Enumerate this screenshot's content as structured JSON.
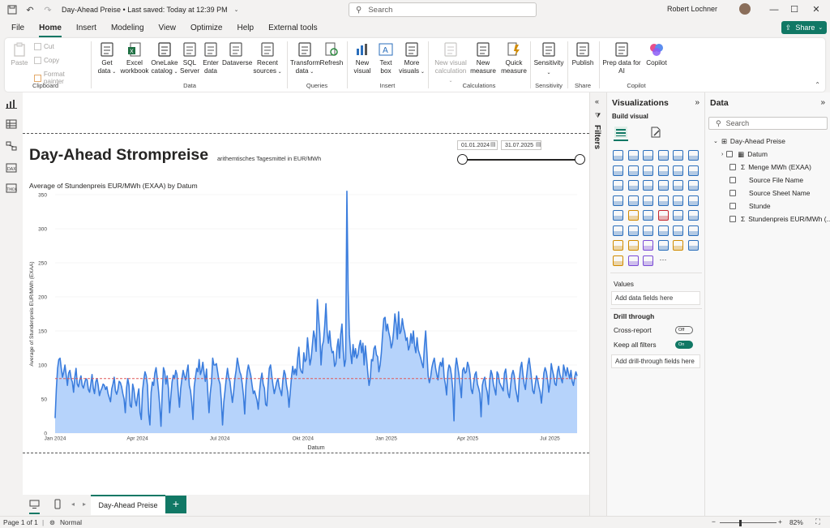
{
  "titlebar": {
    "title": "Day-Ahead Preise • Last saved: Today at 12:39 PM",
    "search_placeholder": "Search",
    "user_name": "Robert Lochner"
  },
  "menu": {
    "items": [
      "File",
      "Home",
      "Insert",
      "Modeling",
      "View",
      "Optimize",
      "Help",
      "External tools"
    ],
    "active": "Home",
    "share": "Share"
  },
  "ribbon": {
    "clipboard": {
      "label": "Clipboard",
      "paste": "Paste",
      "cut": "Cut",
      "copy": "Copy",
      "format_painter": "Format painter"
    },
    "data": {
      "label": "Data",
      "buttons": [
        "Get data",
        "Excel workbook",
        "OneLake catalog",
        "SQL Server",
        "Enter data",
        "Dataverse",
        "Recent sources"
      ]
    },
    "queries": {
      "label": "Queries",
      "buttons": [
        "Transform data",
        "Refresh"
      ]
    },
    "insert": {
      "label": "Insert",
      "buttons": [
        "New visual",
        "Text box",
        "More visuals"
      ]
    },
    "calculations": {
      "label": "Calculations",
      "buttons": [
        "New visual calculation",
        "New measure",
        "Quick measure"
      ]
    },
    "sensitivity": {
      "label": "Sensitivity",
      "buttons": [
        "Sensitivity"
      ]
    },
    "share": {
      "label": "Share",
      "buttons": [
        "Publish"
      ]
    },
    "copilot": {
      "label": "Copilot",
      "buttons": [
        "Prep data for AI",
        "Copilot"
      ]
    }
  },
  "report": {
    "title": "Day-Ahead Strompreise",
    "subtitle": "arithemtisches Tagesmittel in EUR/MWh",
    "visual_title": "Average of Stundenpreis EUR/MWh (EXAA) by Datum",
    "slicer_start": "01.01.2024",
    "slicer_end": "31.07.2025"
  },
  "chart_data": {
    "type": "area",
    "title": "Average of Stundenpreis EUR/MWh (EXAA) by Datum",
    "xlabel": "Datum",
    "ylabel": "Average of Stundenpreis EUR/MWh (EXAA)",
    "ylim": [
      0,
      350
    ],
    "yticks": [
      0,
      50,
      100,
      150,
      200,
      250,
      300,
      350
    ],
    "xticks": [
      "Jan 2024",
      "Apr 2024",
      "Jul 2024",
      "Okt 2024",
      "Jan 2025",
      "Apr 2025",
      "Jul 2025"
    ],
    "average_line": 80,
    "x_start": "2024-01-01",
    "x_end": "2025-07-31",
    "values": [
      22,
      65,
      95,
      108,
      110,
      95,
      82,
      90,
      100,
      85,
      70,
      88,
      92,
      80,
      75,
      60,
      82,
      95,
      72,
      68,
      78,
      84,
      70,
      66,
      74,
      80,
      78,
      64,
      60,
      72,
      86,
      66,
      58,
      75,
      80,
      70,
      55,
      62,
      66,
      72,
      70,
      64,
      68,
      58,
      52,
      46,
      65,
      72,
      82,
      62,
      57,
      64,
      76,
      74,
      68,
      58,
      50,
      30,
      66,
      80,
      70,
      40,
      38,
      72,
      64,
      48,
      40,
      55,
      65,
      30,
      20,
      62,
      78,
      90,
      84,
      70,
      28,
      12,
      60,
      75,
      70,
      88,
      96,
      80,
      62,
      40,
      10,
      58,
      96,
      90,
      72,
      84,
      66,
      30,
      54,
      75,
      85,
      80,
      92,
      86,
      60,
      38,
      65,
      80,
      92,
      84,
      78,
      90,
      100,
      70,
      62,
      45,
      20,
      68,
      82,
      95,
      90,
      108,
      86,
      92,
      104,
      88,
      76,
      94,
      60,
      30,
      58,
      74,
      110,
      100,
      100,
      102,
      90,
      78,
      72,
      48,
      12,
      45,
      62,
      80,
      95,
      82,
      76,
      60,
      45,
      60,
      80,
      92,
      110,
      100,
      90,
      85,
      72,
      55,
      28,
      70,
      90,
      100,
      92,
      84,
      70,
      58,
      62,
      55,
      48,
      35,
      60,
      78,
      88,
      72,
      66,
      42,
      40,
      72,
      95,
      100,
      84,
      70,
      58,
      66,
      75,
      80,
      68,
      62,
      55,
      78,
      92,
      86,
      70,
      60,
      38,
      60,
      82,
      98,
      86,
      94,
      85,
      110,
      126,
      96,
      90,
      88,
      118,
      105,
      108,
      140,
      120,
      100,
      110,
      130,
      150,
      140,
      120,
      196,
      170,
      146,
      100,
      128,
      135,
      158,
      190,
      148,
      132,
      150,
      128,
      118,
      120,
      98,
      102,
      126,
      138,
      110,
      145,
      160,
      122,
      98,
      108,
      355,
      210,
      145,
      118,
      102,
      130,
      112,
      124,
      110,
      115,
      128,
      136,
      118,
      132,
      100,
      128,
      110,
      88,
      70,
      80,
      108,
      106,
      124,
      128,
      115,
      112,
      90,
      100,
      118,
      145,
      168,
      170,
      150,
      160,
      148,
      140,
      125,
      132,
      150,
      175,
      160,
      138,
      178,
      146,
      150,
      168,
      155,
      148,
      136,
      140,
      122,
      128,
      146,
      132,
      150,
      128,
      118,
      140,
      122,
      116,
      110,
      102,
      96,
      128,
      150,
      118,
      84,
      74,
      82,
      96,
      104,
      110,
      96,
      86,
      78,
      96,
      104,
      98,
      110,
      82,
      72,
      56,
      90,
      100,
      96,
      84,
      64,
      18,
      94,
      110,
      98,
      86,
      70,
      52,
      92,
      96,
      88,
      90,
      104,
      98,
      86,
      64,
      58,
      74,
      86,
      90,
      72,
      66,
      58,
      24,
      70,
      78,
      82,
      68,
      60,
      42,
      78,
      92,
      86,
      72,
      64,
      56,
      90,
      86,
      74,
      70,
      66,
      62,
      88,
      94,
      76,
      58,
      52,
      70,
      86,
      92,
      84,
      66,
      56,
      46,
      78,
      96,
      104,
      86,
      72,
      64,
      84,
      100,
      110,
      96,
      80,
      62,
      58,
      72,
      84,
      78,
      68,
      60,
      44,
      64,
      88,
      96,
      90,
      78,
      60,
      74,
      102,
      92,
      84,
      72,
      70,
      90,
      98,
      86,
      80,
      74,
      100,
      92,
      84,
      96,
      88,
      80,
      92,
      76,
      70,
      82,
      90,
      84
    ]
  },
  "pages": {
    "tab": "Day-Ahead Preise"
  },
  "status": {
    "page": "Page 1 of 1",
    "mode": "Normal",
    "zoom": "82%"
  },
  "filters": {
    "label": "Filters"
  },
  "visualizations": {
    "title": "Visualizations",
    "build_visual": "Build visual",
    "values_label": "Values",
    "values_placeholder": "Add data fields here",
    "drill_through": "Drill through",
    "cross_report": "Cross-report",
    "cross_report_state": "Off",
    "keep_filters": "Keep all filters",
    "keep_filters_state": "On",
    "drill_placeholder": "Add drill-through fields here"
  },
  "data_pane": {
    "title": "Data",
    "search_placeholder": "Search",
    "table": "Day-Ahead Preise",
    "fields": [
      "Datum",
      "Menge MWh (EXAA)",
      "Source File Name",
      "Source Sheet Name",
      "Stunde",
      "Stundenpreis EUR/MWh (..."
    ]
  }
}
